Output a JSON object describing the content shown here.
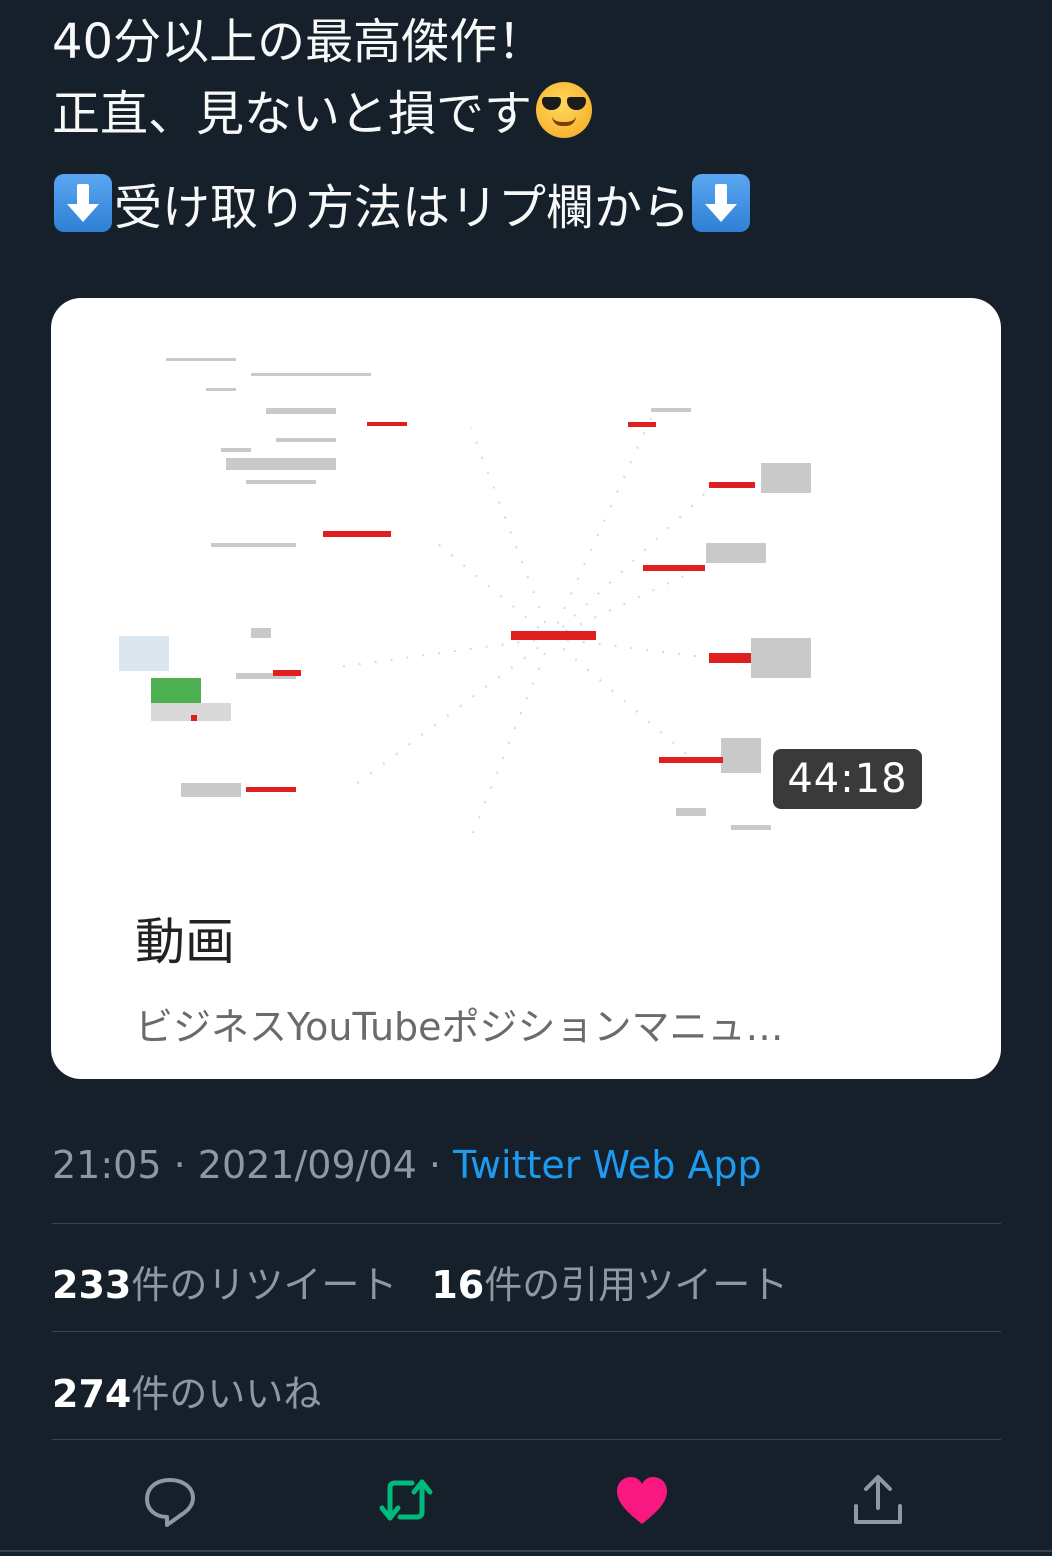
{
  "tweet": {
    "line1": "40分以上の最高傑作！",
    "line2": "正直、見ないと損です",
    "line3": "受け取り方法はリプ欄から",
    "emoji_face": "smiling-face-with-sunglasses",
    "emoji_arrow": "down-arrow"
  },
  "card": {
    "duration": "44:18",
    "title": "動画",
    "subtitle": "ビジネスYouTubeポジションマニュ…"
  },
  "meta": {
    "time": "21:05",
    "dot1": " · ",
    "date": "2021/09/04",
    "dot2": " · ",
    "source": "Twitter Web App"
  },
  "stats": {
    "retweets_count": "233",
    "retweets_label": "件のリツイート",
    "quotes_count": "16",
    "quotes_label": "件の引用ツイート",
    "likes_count": "274",
    "likes_label": "件のいいね"
  },
  "actions": {
    "reply_icon": "speech-bubble",
    "retweet_icon": "retweet-arrows",
    "like_icon": "heart",
    "share_icon": "share-upload",
    "retweet_color": "#00ba7c",
    "like_color": "#f91880"
  },
  "colors": {
    "background": "#15202b",
    "accent": "#1d9bf0",
    "muted": "#8b98a5"
  }
}
